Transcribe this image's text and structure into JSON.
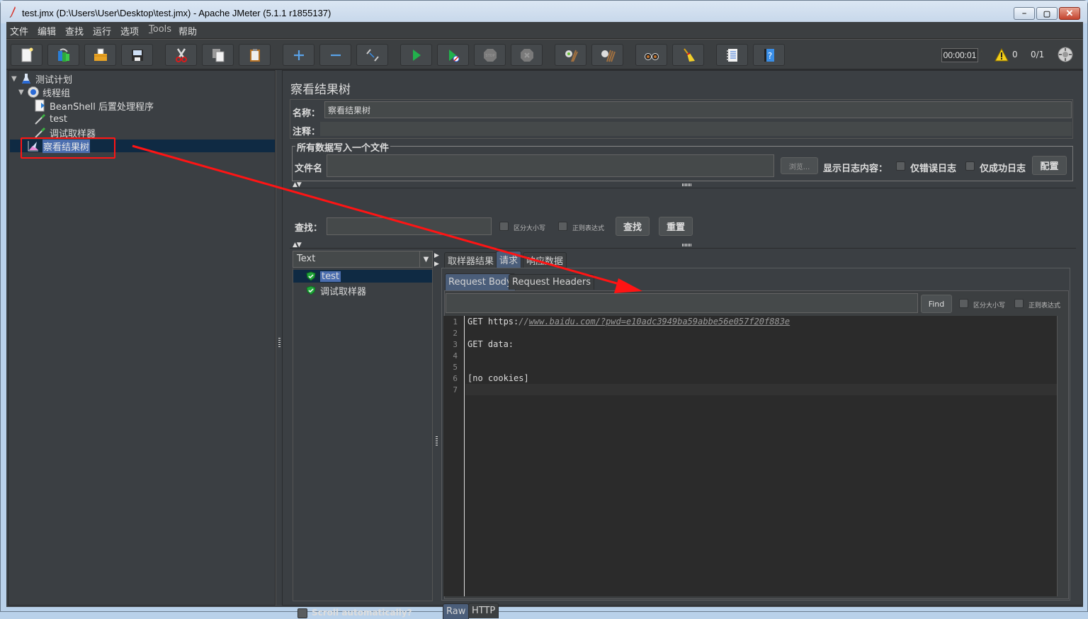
{
  "window": {
    "title": "test.jmx (D:\\Users\\User\\Desktop\\test.jmx) - Apache JMeter (5.1.1 r1855137)",
    "minimize": "–",
    "maximize": "▢",
    "close": "✕"
  },
  "menu": [
    {
      "label": "文件"
    },
    {
      "label": "编辑"
    },
    {
      "label": "查找"
    },
    {
      "label": "运行"
    },
    {
      "label": "选项"
    },
    {
      "label": "Tools",
      "mnemonic": "T"
    },
    {
      "label": "帮助"
    }
  ],
  "toolbar": {
    "buttons": [
      {
        "name": "new",
        "icon": "new-file-icon"
      },
      {
        "name": "templates",
        "icon": "templates-icon"
      },
      {
        "name": "open",
        "icon": "open-folder-icon"
      },
      {
        "name": "save",
        "icon": "save-disk-icon"
      },
      {
        "name": "cut",
        "icon": "scissors-icon"
      },
      {
        "name": "copy",
        "icon": "copy-icon"
      },
      {
        "name": "paste",
        "icon": "paste-clipboard-icon"
      },
      {
        "name": "expand",
        "icon": "plus-icon"
      },
      {
        "name": "collapse",
        "icon": "minus-icon"
      },
      {
        "name": "toggle",
        "icon": "toggle-icon"
      },
      {
        "name": "start",
        "icon": "play-icon"
      },
      {
        "name": "start-no-pauses",
        "icon": "play-no-timers-icon"
      },
      {
        "name": "stop",
        "icon": "stop-icon"
      },
      {
        "name": "shutdown",
        "icon": "shutdown-icon"
      },
      {
        "name": "clear",
        "icon": "clear-broom-gear-icon"
      },
      {
        "name": "clear-all",
        "icon": "clear-all-broom-icon"
      },
      {
        "name": "search",
        "icon": "binoculars-icon"
      },
      {
        "name": "reset-search",
        "icon": "broom-icon"
      },
      {
        "name": "function-helper",
        "icon": "function-list-icon"
      },
      {
        "name": "help",
        "icon": "help-book-icon"
      }
    ],
    "elapsed_time": "00:00:01",
    "warning_count": "0",
    "threads": "0/1"
  },
  "tree": {
    "nodes": [
      {
        "label": "测试计划",
        "icon": "test-plan-flask-icon",
        "expanded": true,
        "level": 0
      },
      {
        "label": "线程组",
        "icon": "thread-group-gear-icon",
        "expanded": true,
        "level": 1
      },
      {
        "label": "BeanShell 后置处理程序",
        "icon": "postprocessor-icon",
        "level": 2
      },
      {
        "label": "test",
        "icon": "sampler-pipette-icon",
        "level": 2
      },
      {
        "label": "调试取样器",
        "icon": "sampler-pipette-icon",
        "level": 2
      },
      {
        "label": "察看结果树",
        "icon": "listener-graph-icon",
        "level": 1,
        "selected": true
      }
    ]
  },
  "panel": {
    "title": "察看结果树",
    "name_label": "名称：",
    "name_value": "察看结果树",
    "comment_label": "注释：",
    "comment_value": "",
    "file_group_title": "所有数据写入一个文件",
    "filename_label": "文件名",
    "filename_value": "",
    "browse_button": "浏览...",
    "log_display_label": "显示日志内容：",
    "errors_only_label": "仅错误日志",
    "success_only_label": "仅成功日志",
    "configure_button": "配置",
    "search_label": "查找：",
    "search_value": "",
    "case_sensitive_label": "区分大小写",
    "regex_label": "正则表达式",
    "search_button": "查找",
    "reset_button": "重置"
  },
  "results": {
    "renderer": "Text",
    "items": [
      {
        "label": "test",
        "status": "success",
        "selected": true
      },
      {
        "label": "调试取样器",
        "status": "success"
      }
    ],
    "scroll_auto_label": "Scroll automatically?"
  },
  "detail": {
    "tabs": [
      {
        "label": "取样器结果"
      },
      {
        "label": "请求",
        "active": true
      },
      {
        "label": "响应数据"
      }
    ],
    "subtabs": [
      {
        "label": "Request Body",
        "active": true
      },
      {
        "label": "Request Headers"
      }
    ],
    "find_value": "",
    "find_button": "Find",
    "case_sensitive_label": "区分大小写",
    "regex_label": "正则表达式",
    "lines": [
      {
        "n": "1",
        "prefix": "GET https:",
        "slash": "//",
        "url": "www.baidu.com/?pwd=e10adc3949ba59abbe56e057f20f883e"
      },
      {
        "n": "2",
        "text": ""
      },
      {
        "n": "3",
        "text": "GET data:"
      },
      {
        "n": "4",
        "text": ""
      },
      {
        "n": "5",
        "text": ""
      },
      {
        "n": "6",
        "text": "[no cookies]"
      },
      {
        "n": "7",
        "text": ""
      }
    ],
    "bottom_tabs": [
      {
        "label": "Raw",
        "active": true
      },
      {
        "label": "HTTP"
      }
    ]
  },
  "annotation": {
    "color": "#ff1414"
  }
}
